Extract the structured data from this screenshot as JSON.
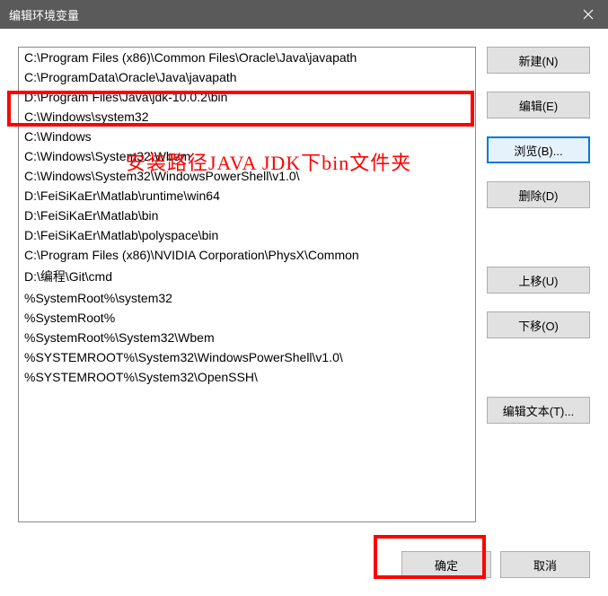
{
  "titlebar": {
    "title": "编辑环境变量"
  },
  "list": {
    "items": [
      "C:\\Program Files (x86)\\Common Files\\Oracle\\Java\\javapath",
      "C:\\ProgramData\\Oracle\\Java\\javapath",
      "D:\\Program Files\\Java\\jdk-10.0.2\\bin",
      "C:\\Windows\\system32",
      "C:\\Windows",
      "C:\\Windows\\System32\\Wbem",
      "C:\\Windows\\System32\\WindowsPowerShell\\v1.0\\",
      "D:\\FeiSiKaEr\\Matlab\\runtime\\win64",
      "D:\\FeiSiKaEr\\Matlab\\bin",
      "D:\\FeiSiKaEr\\Matlab\\polyspace\\bin",
      "C:\\Program Files (x86)\\NVIDIA Corporation\\PhysX\\Common",
      "D:\\编程\\Git\\cmd",
      "%SystemRoot%\\system32",
      "%SystemRoot%",
      "%SystemRoot%\\System32\\Wbem",
      "%SYSTEMROOT%\\System32\\WindowsPowerShell\\v1.0\\",
      "%SYSTEMROOT%\\System32\\OpenSSH\\"
    ]
  },
  "buttons": {
    "new": "新建(N)",
    "edit": "编辑(E)",
    "browse": "浏览(B)...",
    "delete": "删除(D)",
    "moveup": "上移(U)",
    "movedown": "下移(O)",
    "edittext": "编辑文本(T)...",
    "ok": "确定",
    "cancel": "取消"
  },
  "annotation": {
    "text": "安装路径JAVA JDK下bin文件夹"
  }
}
